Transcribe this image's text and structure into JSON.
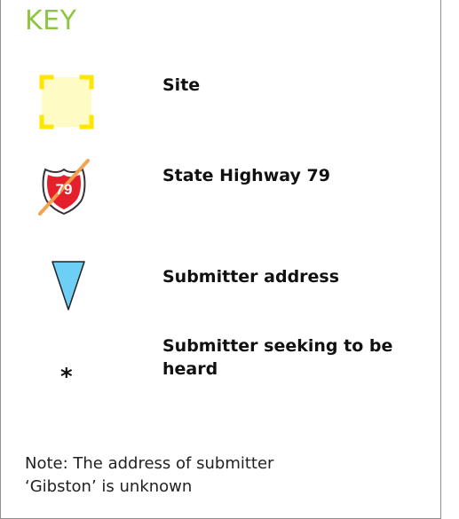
{
  "key": {
    "title": "KEY",
    "items": [
      {
        "symbol": "site-box-icon",
        "label": "Site"
      },
      {
        "symbol": "state-highway-shield-icon",
        "shield_number": "79",
        "label": "State Highway 79"
      },
      {
        "symbol": "blue-triangle-icon",
        "label": "Submitter address"
      },
      {
        "symbol": "asterisk-icon",
        "glyph": "*",
        "label": "Submitter seeking to be heard"
      }
    ],
    "note": "Note: The address of submitter ‘Gibston’ is unknown"
  },
  "colors": {
    "title": "#8dc63f",
    "site_fill": "#fffbc4",
    "site_corners": "#ffe600",
    "shield_red": "#e3202c",
    "highway_line": "#f0a04b",
    "triangle_fill": "#6ecff6",
    "border": "#8f8f8f"
  }
}
